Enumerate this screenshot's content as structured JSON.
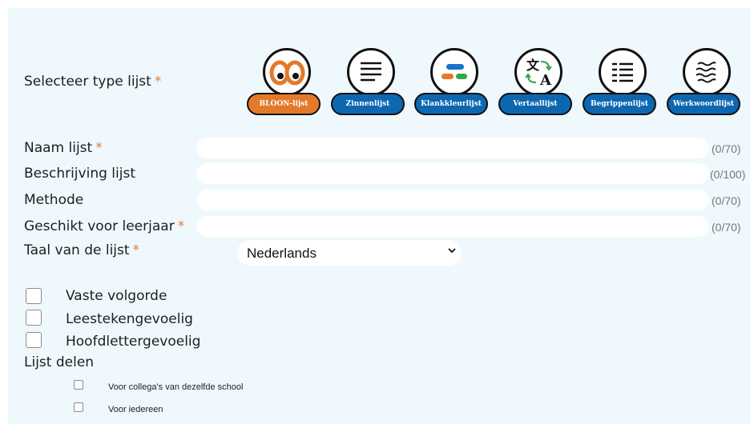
{
  "type_section": {
    "label": "Selecteer type lijst",
    "required_mark": "*",
    "types": [
      {
        "icon": "eyes-icon",
        "label": "BLOON-lijst",
        "active": true
      },
      {
        "icon": "lines-icon",
        "label": "Zinnenlijst",
        "active": false
      },
      {
        "icon": "color-bars-icon",
        "label": "Klankkleurlijst",
        "active": false
      },
      {
        "icon": "translate-icon",
        "label": "Vertaallijst",
        "active": false
      },
      {
        "icon": "definition-list-icon",
        "label": "Begrippenlijst",
        "active": false
      },
      {
        "icon": "wavy-lines-icon",
        "label": "Werkwoordlijst",
        "active": false
      }
    ]
  },
  "fields": [
    {
      "label": "Naam lijst",
      "required": true,
      "value": "",
      "counter": "(0/70)"
    },
    {
      "label": "Beschrijving lijst",
      "required": false,
      "value": "",
      "counter": "(0/100)"
    },
    {
      "label": "Methode",
      "required": false,
      "value": "",
      "counter": "(0/70)"
    },
    {
      "label": "Geschikt voor leerjaar",
      "required": true,
      "value": "",
      "counter": "(0/70)"
    }
  ],
  "language": {
    "label": "Taal van de lijst",
    "required": true,
    "selected": "Nederlands"
  },
  "options": [
    {
      "label": "Vaste volgorde",
      "checked": false
    },
    {
      "label": "Leestekengevoelig",
      "checked": false
    },
    {
      "label": "Hoofdlettergevoelig",
      "checked": false
    }
  ],
  "share": {
    "label": "Lijst delen",
    "options": [
      {
        "label": "Voor collega's van dezelfde school",
        "checked": false
      },
      {
        "label": "Voor iedereen",
        "checked": false
      }
    ]
  },
  "colors": {
    "panel_bg": "#eff8fd",
    "accent_orange": "#e27a2a",
    "accent_blue": "#0d67b0",
    "required_mark": "#e87a3a"
  }
}
